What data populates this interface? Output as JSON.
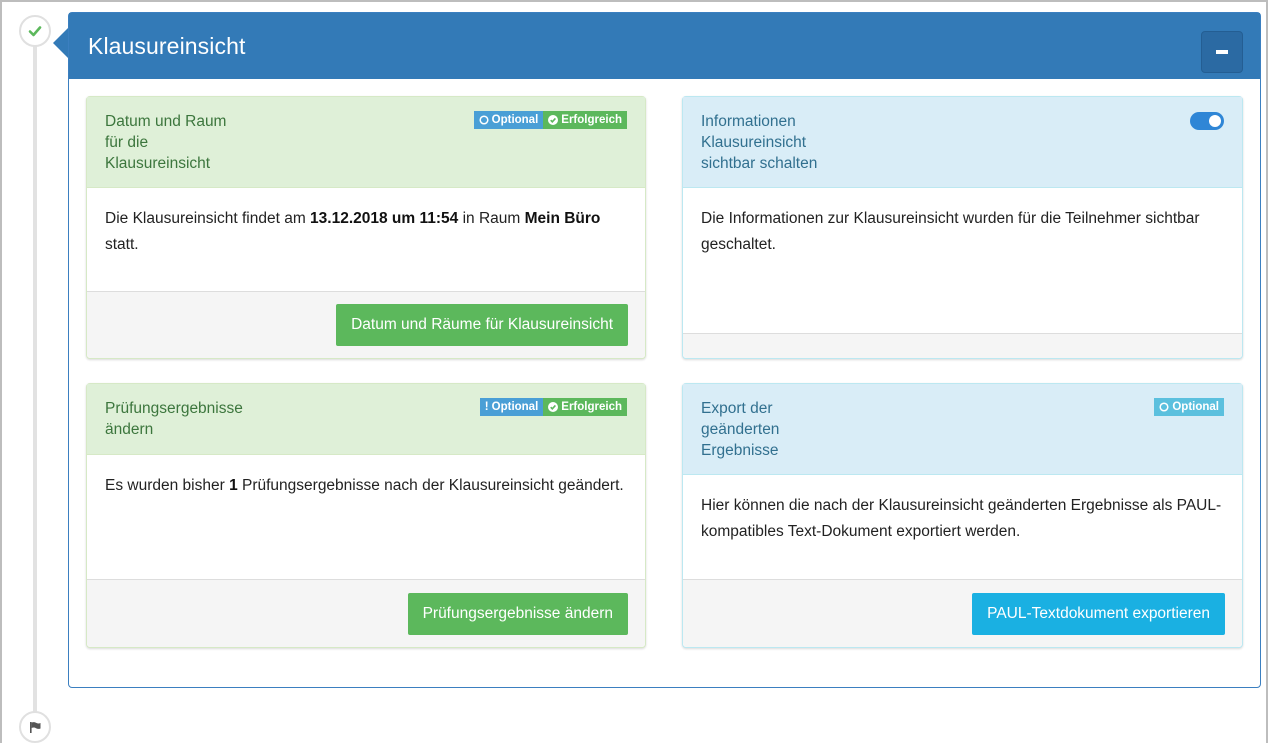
{
  "panel": {
    "title": "Klausureinsicht",
    "collapse_label": "Zuklappen"
  },
  "colors": {
    "header_blue": "#337ab7",
    "success_green": "#5cb85c",
    "info_cyan": "#1ab0e2"
  },
  "cards": {
    "date_room": {
      "title_lines": [
        "Datum und Raum",
        "für die",
        "Klausureinsicht"
      ],
      "badge_optional": "Optional",
      "badge_optional_icon": "circle-icon",
      "badge_success": "Erfolgreich",
      "badge_success_icon": "check-circle-icon",
      "body_prefix": "Die Klausureinsicht findet am ",
      "body_date": "13.12.2018 um 11:54",
      "body_mid": " in Raum ",
      "body_room": "Mein Büro",
      "body_suffix": " statt.",
      "button": "Datum und Räume für Klausureinsicht"
    },
    "visibility": {
      "title_lines": [
        "Informationen",
        "Klausureinsicht",
        "sichtbar schalten"
      ],
      "toggle_state": "on",
      "body": "Die Informationen zur Klausureinsicht wurden für die Teilnehmer sichtbar geschaltet."
    },
    "results": {
      "title_lines": [
        "Prüfungsergebnisse",
        "ändern"
      ],
      "badge_optional": "Optional",
      "badge_optional_icon": "exclamation-icon",
      "badge_success": "Erfolgreich",
      "badge_success_icon": "check-circle-icon",
      "body_prefix": "Es wurden bisher ",
      "body_count": "1",
      "body_suffix": " Prüfungsergebnisse nach der Klausureinsicht geändert.",
      "button": "Prüfungsergebnisse ändern"
    },
    "export": {
      "title_lines": [
        "Export der",
        "geänderten",
        "Ergebnisse"
      ],
      "badge_optional": "Optional",
      "badge_optional_icon": "circle-icon",
      "body": "Hier können die nach der Klausureinsicht geänderten Ergebnisse als PAUL-kompatibles Text-Dokument exportiert werden.",
      "button": "PAUL-Textdokument exportieren"
    }
  },
  "timeline": {
    "step_icon": "check-icon",
    "end_icon": "flag-icon"
  }
}
